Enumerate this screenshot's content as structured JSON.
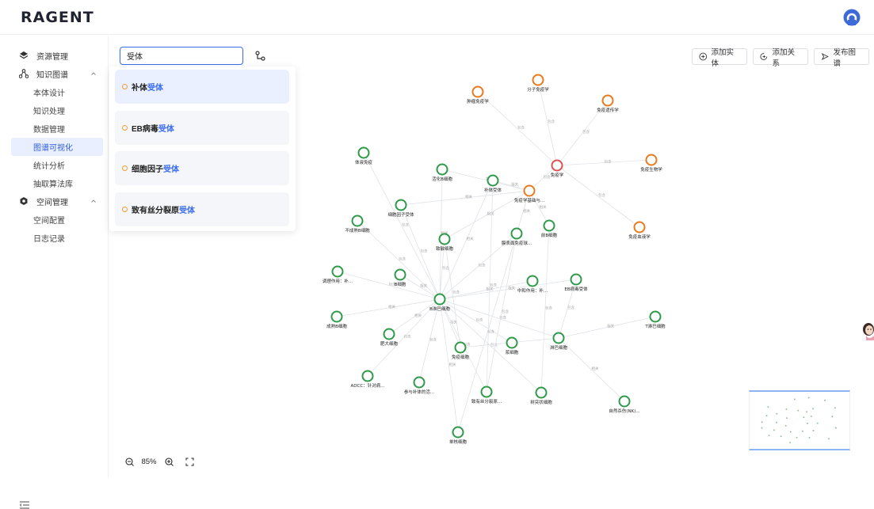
{
  "header": {
    "logo": "RAGENT"
  },
  "sidebar": {
    "items": [
      {
        "label": "资源管理",
        "type": "group",
        "icon": "layers-icon"
      },
      {
        "label": "知识图谱",
        "type": "group",
        "icon": "graph-icon",
        "expanded": true
      },
      {
        "label": "本体设计",
        "type": "sub"
      },
      {
        "label": "知识处理",
        "type": "sub"
      },
      {
        "label": "数据管理",
        "type": "sub"
      },
      {
        "label": "图谱可视化",
        "type": "sub",
        "active": true
      },
      {
        "label": "统计分析",
        "type": "sub"
      },
      {
        "label": "抽取算法库",
        "type": "sub"
      },
      {
        "label": "空间管理",
        "type": "group",
        "icon": "settings-icon",
        "expanded": true
      },
      {
        "label": "空间配置",
        "type": "sub"
      },
      {
        "label": "日志记录",
        "type": "sub"
      }
    ]
  },
  "search": {
    "value": "受体"
  },
  "dropdown": {
    "options": [
      {
        "prefix": "补体",
        "keyword": "受体"
      },
      {
        "prefix": "EB病毒",
        "keyword": "受体"
      },
      {
        "prefix": "细胞因子",
        "keyword": "受体"
      },
      {
        "prefix": "致有丝分裂原",
        "keyword": "受体"
      }
    ]
  },
  "toolbar": {
    "add_entity": "添加实体",
    "add_relation": "添加关系",
    "publish": "发布图谱"
  },
  "zoom": {
    "value": "85%"
  },
  "colors": {
    "accent": "#3a6cf0",
    "concept_node": "#ea7a1f",
    "center_node": "#e05050",
    "entity_node": "#2e9a4a"
  },
  "graph": {
    "nodes": [
      {
        "id": "n1",
        "label": "肿瘤免疫学",
        "kind": "concept"
      },
      {
        "id": "n2",
        "label": "分子免疫学",
        "kind": "concept"
      },
      {
        "id": "n3",
        "label": "免疫遗传学",
        "kind": "concept"
      },
      {
        "id": "n4",
        "label": "免疫学",
        "kind": "center"
      },
      {
        "id": "n5",
        "label": "免疫生物学",
        "kind": "concept"
      },
      {
        "id": "n6",
        "label": "免疫学基础与...",
        "kind": "concept"
      },
      {
        "id": "n7",
        "label": "免疫血液学",
        "kind": "concept"
      },
      {
        "id": "n8",
        "label": "体液免疫",
        "kind": "entity"
      },
      {
        "id": "n9",
        "label": "活化B细胞",
        "kind": "entity"
      },
      {
        "id": "n10",
        "label": "补体受体",
        "kind": "entity"
      },
      {
        "id": "n11",
        "label": "细胞因子受体",
        "kind": "entity"
      },
      {
        "id": "n12",
        "label": "不成熟B细胞",
        "kind": "entity"
      },
      {
        "id": "n13",
        "label": "致敏细胞",
        "kind": "entity"
      },
      {
        "id": "n14",
        "label": "膜表面免疫球...",
        "kind": "entity"
      },
      {
        "id": "n15",
        "label": "前B细胞",
        "kind": "entity"
      },
      {
        "id": "n16",
        "label": "调理作用：补...",
        "kind": "entity"
      },
      {
        "id": "n17",
        "label": "B细胞",
        "kind": "entity"
      },
      {
        "id": "n18",
        "label": "中和作用：补...",
        "kind": "entity"
      },
      {
        "id": "n19",
        "label": "EB病毒受体",
        "kind": "entity"
      },
      {
        "id": "n20",
        "label": "B淋巴细胞",
        "kind": "entity"
      },
      {
        "id": "n21",
        "label": "成熟B细胞",
        "kind": "entity"
      },
      {
        "id": "n22",
        "label": "T淋巴细胞",
        "kind": "entity"
      },
      {
        "id": "n23",
        "label": "肥大细胞",
        "kind": "entity"
      },
      {
        "id": "n24",
        "label": "免疫细胞",
        "kind": "entity"
      },
      {
        "id": "n25",
        "label": "浆细胞",
        "kind": "entity"
      },
      {
        "id": "n26",
        "label": "淋巴细胞",
        "kind": "entity"
      },
      {
        "id": "n27",
        "label": "ADCC：针对病...",
        "kind": "entity"
      },
      {
        "id": "n28",
        "label": "参与补体的活...",
        "kind": "entity"
      },
      {
        "id": "n29",
        "label": "致有丝分裂原...",
        "kind": "entity"
      },
      {
        "id": "n30",
        "label": "树突状细胞",
        "kind": "entity"
      },
      {
        "id": "n31",
        "label": "自然杀伤(NK)...",
        "kind": "entity"
      },
      {
        "id": "n32",
        "label": "单核细胞",
        "kind": "entity"
      }
    ],
    "edge_labels": [
      "包含",
      "包含",
      "包含",
      "包含",
      "包含",
      "包含",
      "相关",
      "相关",
      "相关",
      "相关",
      "相关",
      "相关"
    ]
  }
}
